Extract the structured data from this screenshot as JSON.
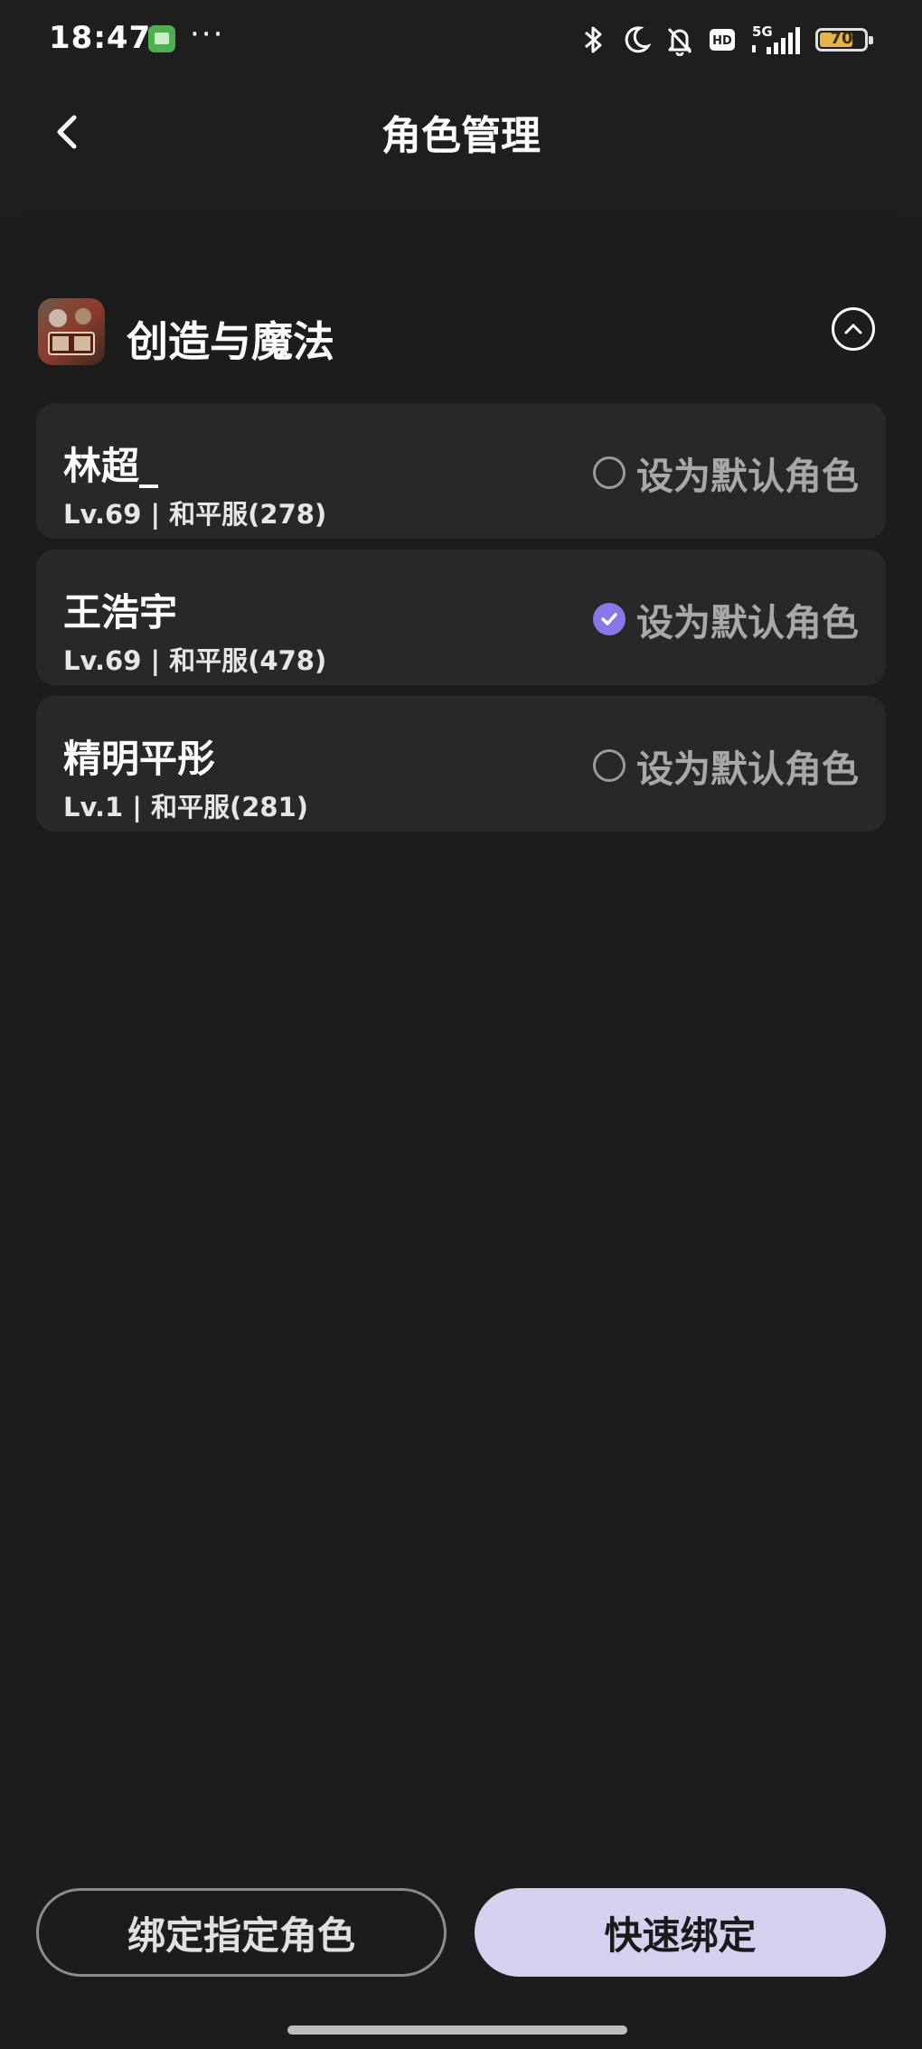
{
  "status_bar": {
    "time": "18:47",
    "dots": "···",
    "network": "5G",
    "hd_label": "HD",
    "battery_level": "70",
    "icons": [
      "app-notification-icon",
      "bluetooth-icon",
      "moon-icon",
      "bell-off-icon",
      "hd-icon",
      "signal-icon",
      "battery-icon"
    ]
  },
  "header": {
    "title": "角色管理",
    "back_icon": "chevron-left-icon"
  },
  "game": {
    "name": "创造与魔法",
    "collapse_icon": "chevron-up-circle-icon"
  },
  "roles": [
    {
      "name": "林超_",
      "meta": "Lv.69 | 和平服(278)",
      "default_label": "设为默认角色",
      "is_default": false
    },
    {
      "name": "王浩宇",
      "meta": "Lv.69 | 和平服(478)",
      "default_label": "设为默认角色",
      "is_default": true
    },
    {
      "name": "精明平彤",
      "meta": "Lv.1 | 和平服(281)",
      "default_label": "设为默认角色",
      "is_default": false
    }
  ],
  "actions": {
    "bind_specific": "绑定指定角色",
    "quick_bind": "快速绑定"
  },
  "colors": {
    "background": "#1c1c1c",
    "card": "#282828",
    "accent": "#8a76e8",
    "primary_button": "#d4d0ee"
  }
}
